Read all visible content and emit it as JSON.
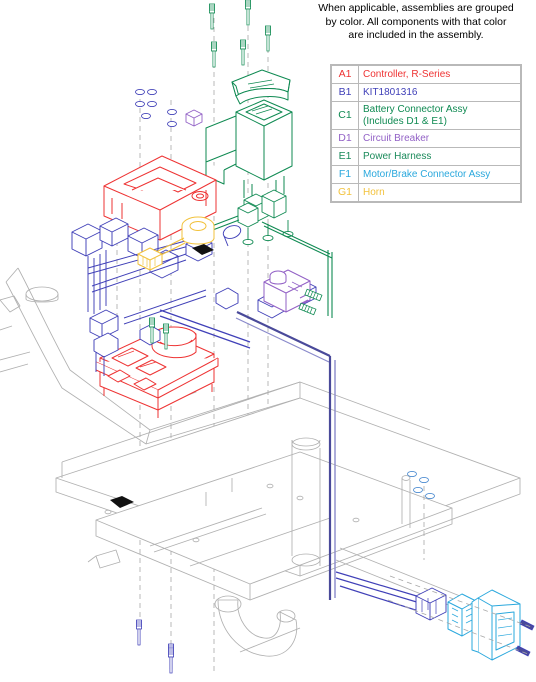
{
  "note": {
    "line1": "When applicable, assemblies are grouped",
    "line2": "by color. All components with that color",
    "line3": "are included in the assembly."
  },
  "legend": {
    "rows": [
      {
        "code": "A1",
        "desc": "Controller, R-Series",
        "desc2": "",
        "color": "#ee3333"
      },
      {
        "code": "B1",
        "desc": "KIT1801316",
        "desc2": "",
        "color": "#4040b8"
      },
      {
        "code": "C1",
        "desc": "Battery Connector Assy",
        "desc2": "(Includes D1 & E1)",
        "color": "#0f8a52"
      },
      {
        "code": "D1",
        "desc": "Circuit Breaker",
        "desc2": "",
        "color": "#9261c6"
      },
      {
        "code": "E1",
        "desc": "Power Harness",
        "desc2": "",
        "color": "#1a8a5a"
      },
      {
        "code": "F1",
        "desc": "Motor/Brake Connector Assy",
        "desc2": "",
        "color": "#2aa8dd"
      },
      {
        "code": "G1",
        "desc": "Horn",
        "desc2": "",
        "color": "#f2c23c"
      }
    ]
  },
  "colors": {
    "red": "#ee3333",
    "blue": "#4040b8",
    "green": "#0f8a52",
    "purple": "#9261c6",
    "cyan": "#2aa8dd",
    "yellow": "#f2c23c",
    "chassis": "#b0b0b0",
    "guide": "#a8a8a8",
    "background": "#ffffff"
  },
  "drawing": {
    "title": "exploded-view-parts-diagram",
    "components": [
      {
        "id": "A1",
        "name": "controller-r-series",
        "color": "#ee3333"
      },
      {
        "id": "B1",
        "name": "wiring-harness-kit",
        "color": "#4040b8"
      },
      {
        "id": "C1",
        "name": "battery-connector-assy",
        "color": "#0f8a52"
      },
      {
        "id": "D1",
        "name": "circuit-breaker",
        "color": "#9261c6"
      },
      {
        "id": "E1",
        "name": "power-harness",
        "color": "#1a8a5a"
      },
      {
        "id": "F1",
        "name": "motor-brake-connector-assy",
        "color": "#2aa8dd"
      },
      {
        "id": "G1",
        "name": "horn",
        "color": "#f2c23c"
      }
    ]
  }
}
